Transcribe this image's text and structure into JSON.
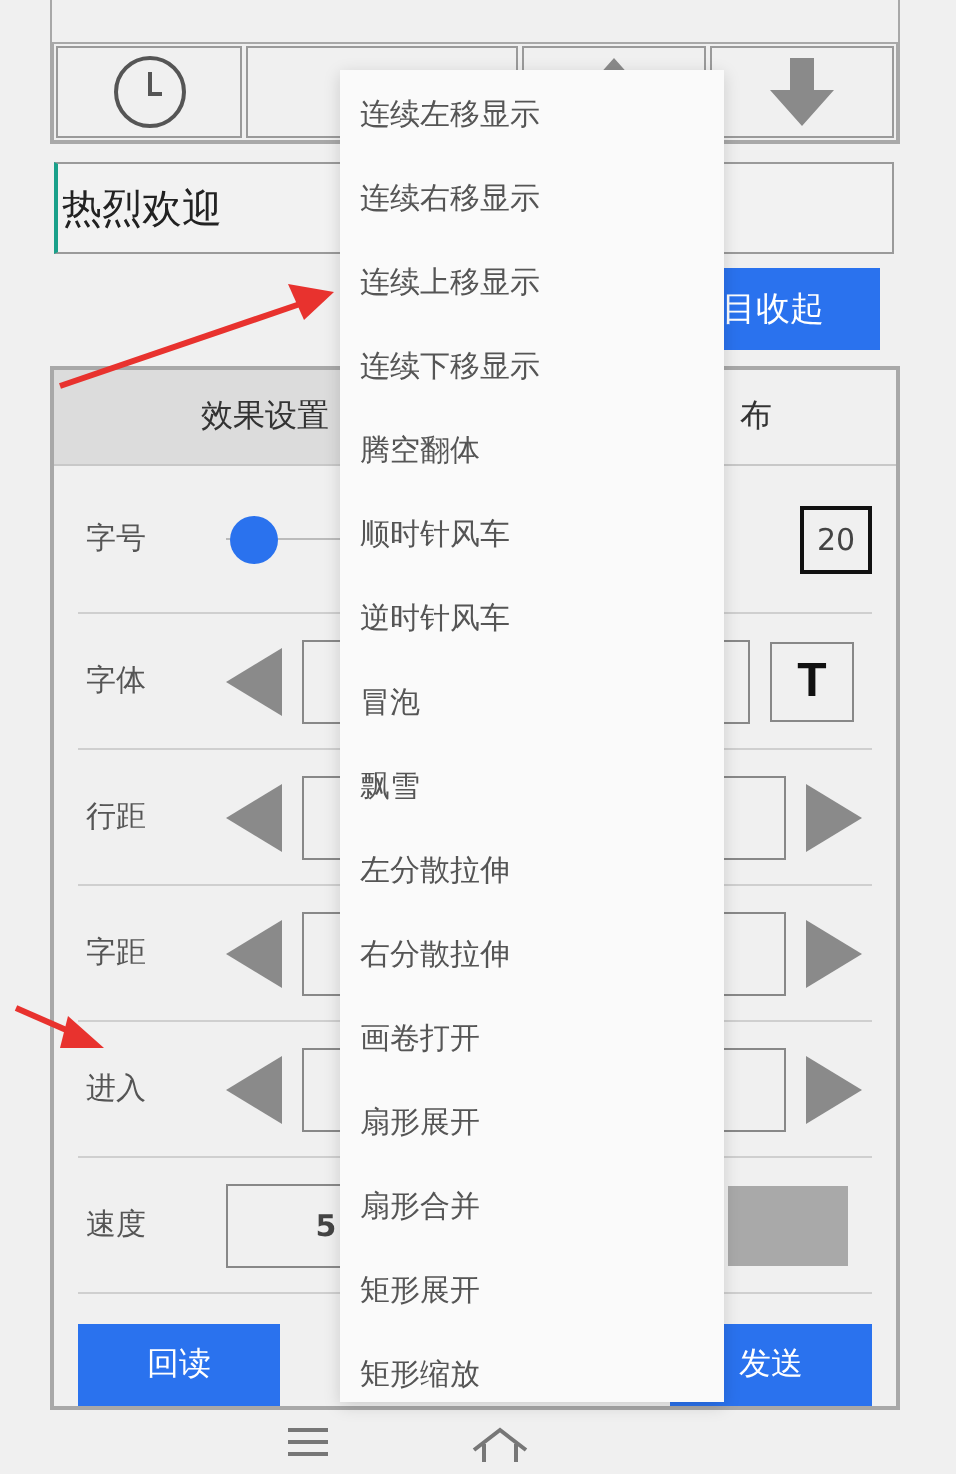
{
  "toolbar": [
    {
      "kind": "clock"
    },
    {
      "kind": "blank"
    },
    {
      "kind": "up"
    },
    {
      "kind": "down"
    }
  ],
  "message_field": {
    "value": "热烈欢迎"
  },
  "collapse_button": {
    "label": "目收起"
  },
  "tabs": [
    {
      "label": "效果设置",
      "selected": true
    },
    {
      "label": "布",
      "selected": false
    }
  ],
  "settings": [
    {
      "kind": "slider",
      "label": "字号",
      "level": 0.06,
      "value": "20"
    },
    {
      "kind": "font",
      "label": "字体",
      "icon_label": "T"
    },
    {
      "kind": "stepper",
      "label": "行距"
    },
    {
      "kind": "stepper",
      "label": "字距"
    },
    {
      "kind": "stepper",
      "label": "进入"
    },
    {
      "kind": "speed",
      "label": "速度",
      "value": "5"
    }
  ],
  "actions": [
    {
      "label": "回读"
    },
    {
      "label": "发送"
    }
  ],
  "menu": {
    "items": [
      "连续左移显示",
      "连续右移显示",
      "连续上移显示",
      "连续下移显示",
      "腾空翻体",
      "顺时针风车",
      "逆时针风车",
      "冒泡",
      "飘雪",
      "左分散拉伸",
      "右分散拉伸",
      "画卷打开",
      "扇形展开",
      "扇形合并",
      "矩形展开",
      "矩形缩放"
    ]
  },
  "nav": [
    {
      "kind": "menu"
    },
    {
      "kind": "home"
    }
  ]
}
